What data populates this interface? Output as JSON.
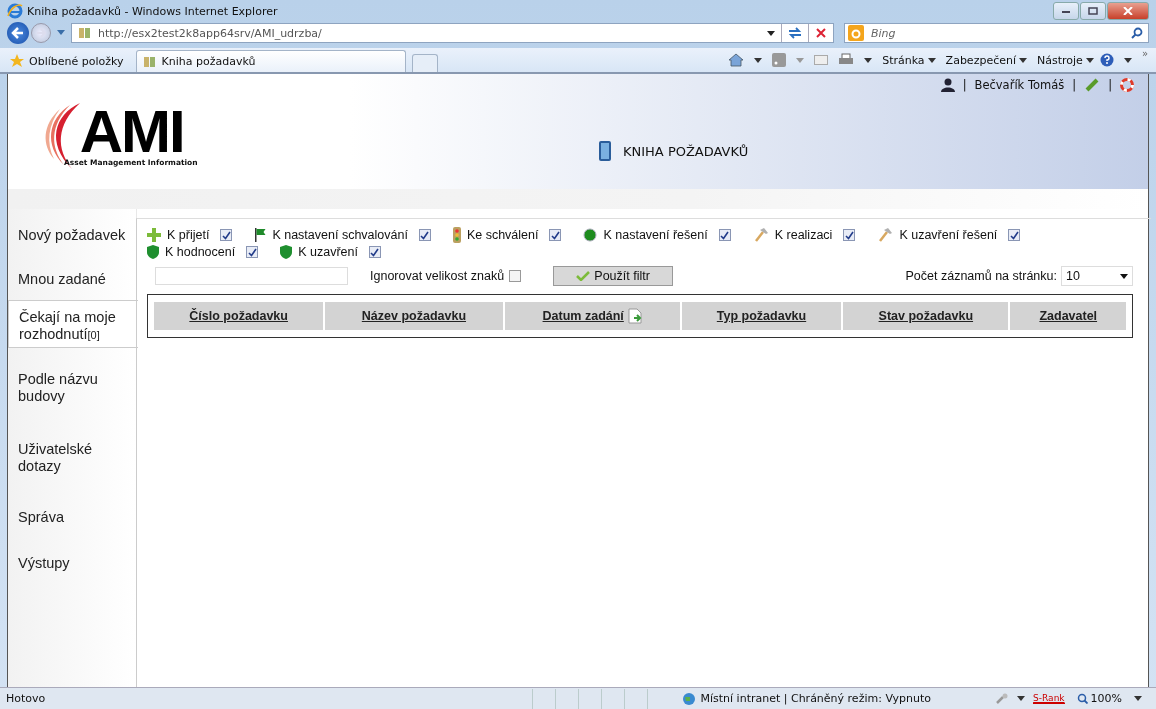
{
  "window": {
    "title": "Kniha požadavků - Windows Internet Explorer"
  },
  "address_bar": {
    "url": "http://esx2test2k8app64srv/AMI_udrzba/"
  },
  "search": {
    "placeholder": "Bing"
  },
  "favorites": {
    "label": "Oblíbené položky"
  },
  "tabs": [
    {
      "label": "Kniha požadavků",
      "selected": true
    }
  ],
  "command_bar": {
    "menus": [
      "Stránka",
      "Zabezpečení",
      "Nástroje"
    ],
    "overflow": "»"
  },
  "user_bar": {
    "separator": "|",
    "user": "Bečvařík Tomáš"
  },
  "logo": {
    "text": "AMI",
    "tagline": "Asset Management Information"
  },
  "page_title": "KNIHA POŽADAVKŮ",
  "sidebar": {
    "items": [
      {
        "label": "Nový požadavek",
        "selected": false
      },
      {
        "label": "Mnou zadané",
        "selected": false
      },
      {
        "label": "Čekají na moje rozhodnutí",
        "count": "[0]",
        "selected": true
      },
      {
        "label": "Podle názvu budovy",
        "selected": false
      },
      {
        "label": "Uživatelské dotazy",
        "selected": false
      },
      {
        "label": "Správa",
        "selected": false
      },
      {
        "label": "Výstupy",
        "selected": false
      }
    ]
  },
  "filters": [
    {
      "kind": "plus",
      "label": "K přijetí",
      "checked": true
    },
    {
      "kind": "flag",
      "label": "K nastavení schvalování",
      "checked": true
    },
    {
      "kind": "light",
      "label": "Ke schválení",
      "checked": true
    },
    {
      "kind": "dot",
      "label": "K nastavení řešení",
      "checked": true
    },
    {
      "kind": "hammer",
      "label": "K realizaci",
      "checked": true
    },
    {
      "kind": "hammer",
      "label": "K uzavření řešení",
      "checked": true
    },
    {
      "kind": "shield",
      "label": "K hodnocení",
      "checked": true
    },
    {
      "kind": "shield",
      "label": "K uzavření",
      "checked": true
    }
  ],
  "filter_bar": {
    "ignore_case_label": "Ignorovat velikost znaků",
    "ignore_case": false,
    "apply_button": "Použít filtr",
    "page_size_label": "Počet záznamů na stránku:",
    "page_size": "10"
  },
  "table": {
    "columns": [
      {
        "label": "Číslo požadavku",
        "sorted": false
      },
      {
        "label": "Název požadavku",
        "sorted": false
      },
      {
        "label": "Datum zadání",
        "sorted": true
      },
      {
        "label": "Typ požadavku",
        "sorted": false
      },
      {
        "label": "Stav požadavku",
        "sorted": false
      },
      {
        "label": "Zadavatel",
        "sorted": false
      }
    ]
  },
  "status_bar": {
    "status": "Hotovo",
    "zone": "Místní intranet | Chráněný režim: Vypnuto",
    "rank": "S-Rank",
    "zoom": "100%"
  }
}
